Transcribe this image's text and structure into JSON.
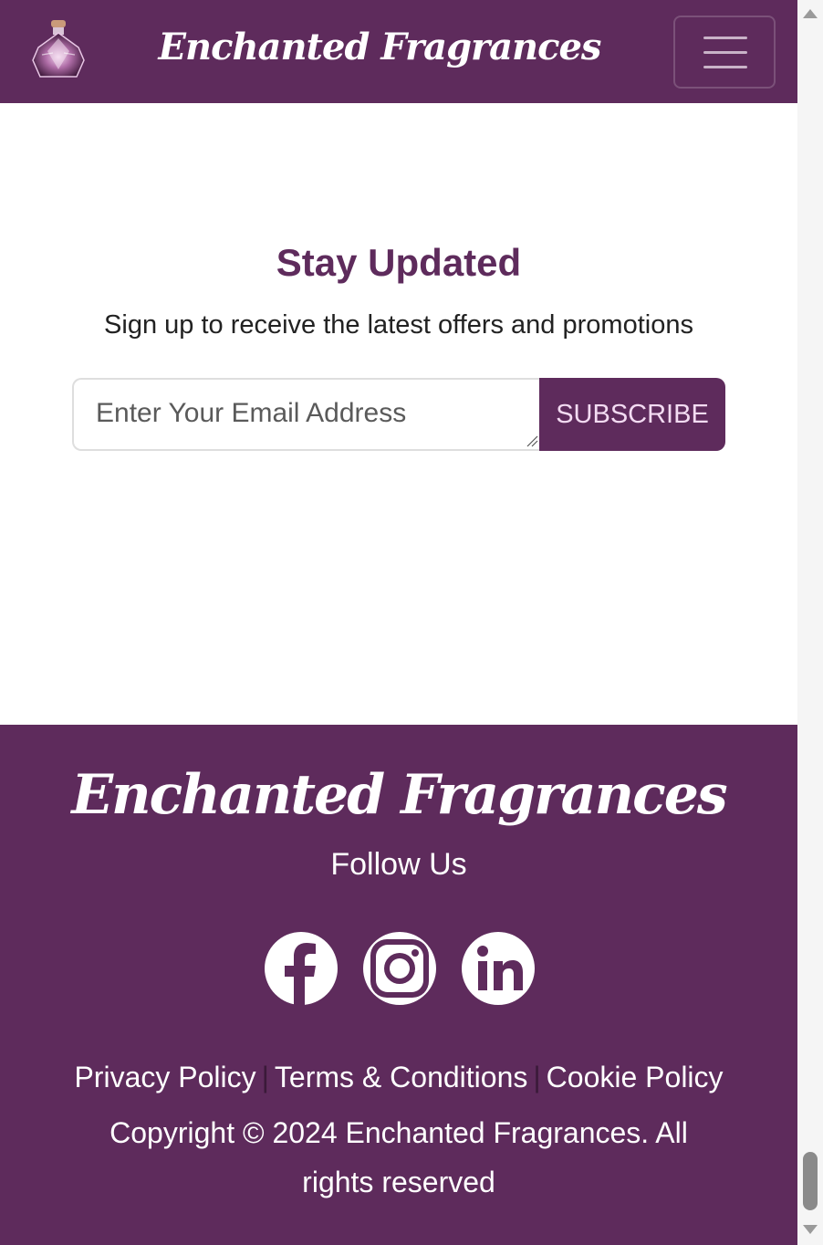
{
  "header": {
    "brand": "Enchanted Fragrances",
    "logo_icon": "perfume-bottle-icon",
    "menu_icon": "hamburger-menu-icon"
  },
  "newsletter": {
    "title": "Stay Updated",
    "subtitle": "Sign up to receive the latest offers and promotions",
    "email_placeholder": "Enter Your Email Address",
    "email_value": "",
    "subscribe_label": "SUBSCRIBE"
  },
  "footer": {
    "brand": "Enchanted Fragrances",
    "follow_label": "Follow Us",
    "social_icons": [
      "facebook-icon",
      "instagram-icon",
      "linkedin-icon"
    ],
    "links": [
      "Privacy Policy",
      "Terms & Conditions",
      "Cookie Policy"
    ],
    "separator": "|",
    "copyright": "Copyright © 2024 Enchanted Fragrances. All rights reserved"
  },
  "colors": {
    "brand_purple": "#5e2b5c",
    "white": "#ffffff",
    "button_text": "#f3dbf2"
  }
}
